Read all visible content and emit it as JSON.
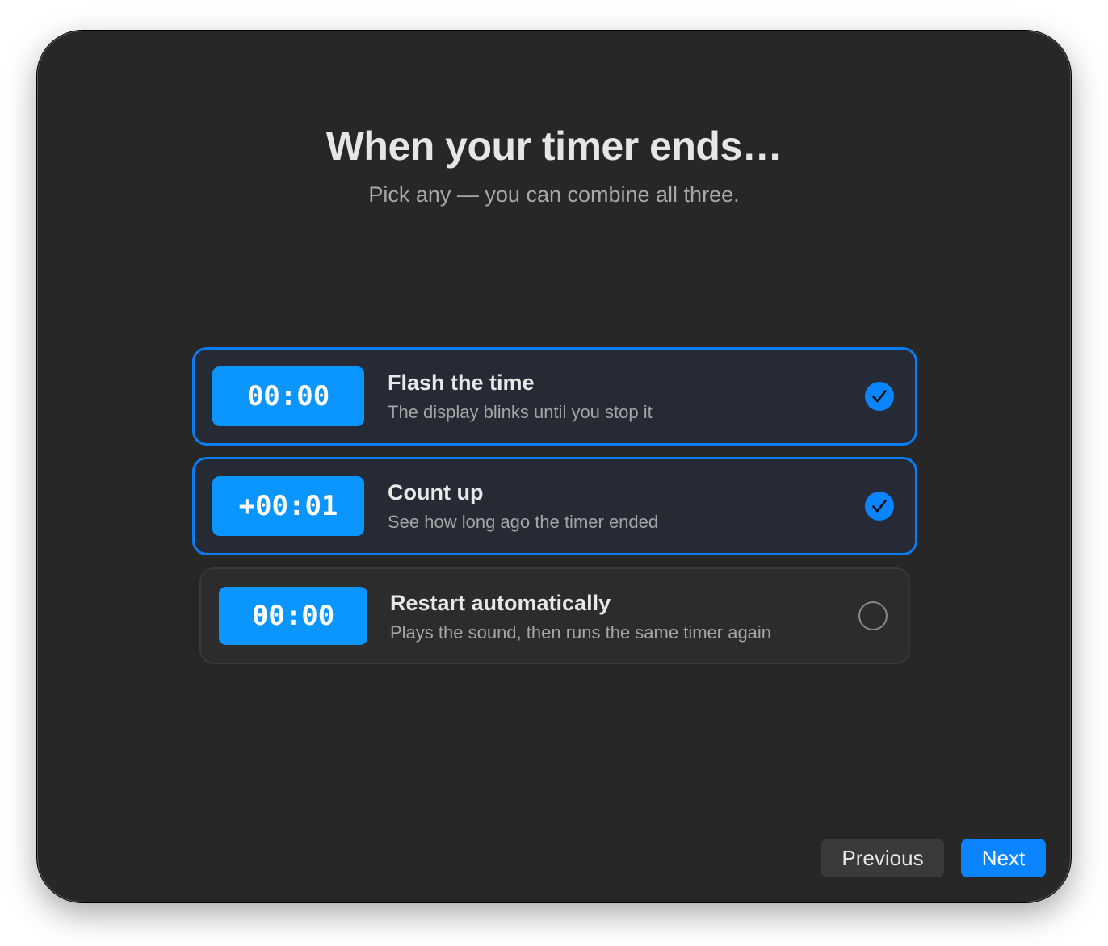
{
  "header": {
    "title": "When your timer ends…",
    "subtitle": "Pick any — you can combine all three."
  },
  "options": [
    {
      "badge": "00:00",
      "title": "Flash the time",
      "description": "The display blinks until you stop it",
      "selected": true
    },
    {
      "badge": "+00:01",
      "title": "Count up",
      "description": "See how long ago the timer ended",
      "selected": true
    },
    {
      "badge": "00:00",
      "title": "Restart automatically",
      "description": "Plays the sound, then runs the same timer again",
      "selected": false
    }
  ],
  "footer": {
    "previous_label": "Previous",
    "next_label": "Next"
  },
  "colors": {
    "accent": "#0a84ff",
    "badge": "#0a95ff",
    "background": "#272727"
  },
  "icons": {
    "selected": "checkmark-circle-icon",
    "unselected": "empty-circle-icon"
  }
}
